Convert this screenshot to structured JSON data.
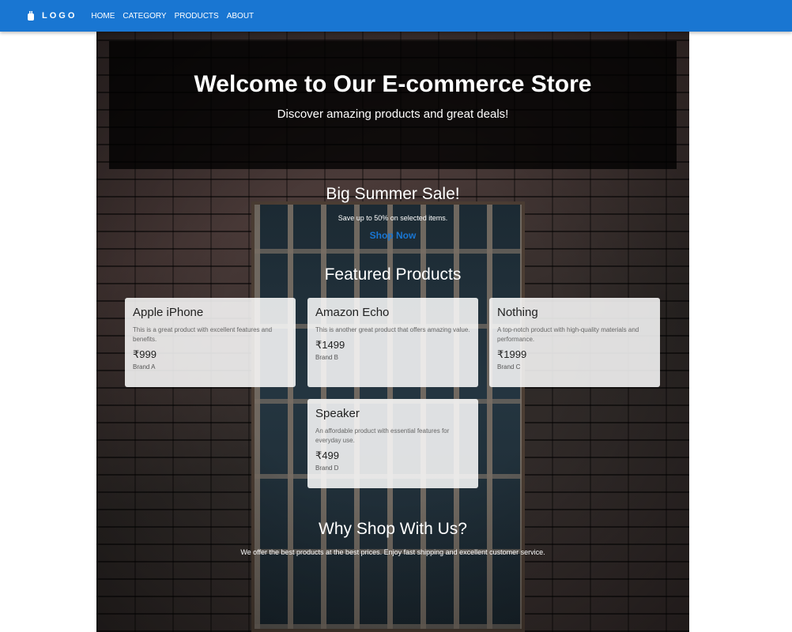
{
  "nav": {
    "logo_text": "LOGO",
    "links": [
      "HOME",
      "CATEGORY",
      "PRODUCTS",
      "ABOUT"
    ]
  },
  "header": {
    "title": "Welcome to Our E-commerce Store",
    "subtitle": "Discover amazing products and great deals!"
  },
  "sale": {
    "title": "Big Summer Sale!",
    "text": "Save up to 50% on selected items.",
    "link": "Shop Now"
  },
  "featured": {
    "title": "Featured Products",
    "products": [
      {
        "name": "Apple iPhone",
        "desc": "This is a great product with excellent features and benefits.",
        "price": "₹999",
        "brand": "Brand A"
      },
      {
        "name": "Amazon Echo",
        "desc": "This is another great product that offers amazing value.",
        "price": "₹1499",
        "brand": "Brand B"
      },
      {
        "name": "Nothing",
        "desc": "A top-notch product with high-quality materials and performance.",
        "price": "₹1999",
        "brand": "Brand C"
      },
      {
        "name": "Speaker",
        "desc": "An affordable product with essential features for everyday use.",
        "price": "₹499",
        "brand": "Brand D"
      }
    ]
  },
  "why": {
    "title": "Why Shop With Us?",
    "text": "We offer the best products at the best prices. Enjoy fast shipping and excellent customer service."
  },
  "colors": {
    "navbar": "#1976d2",
    "link": "#1976d2"
  }
}
